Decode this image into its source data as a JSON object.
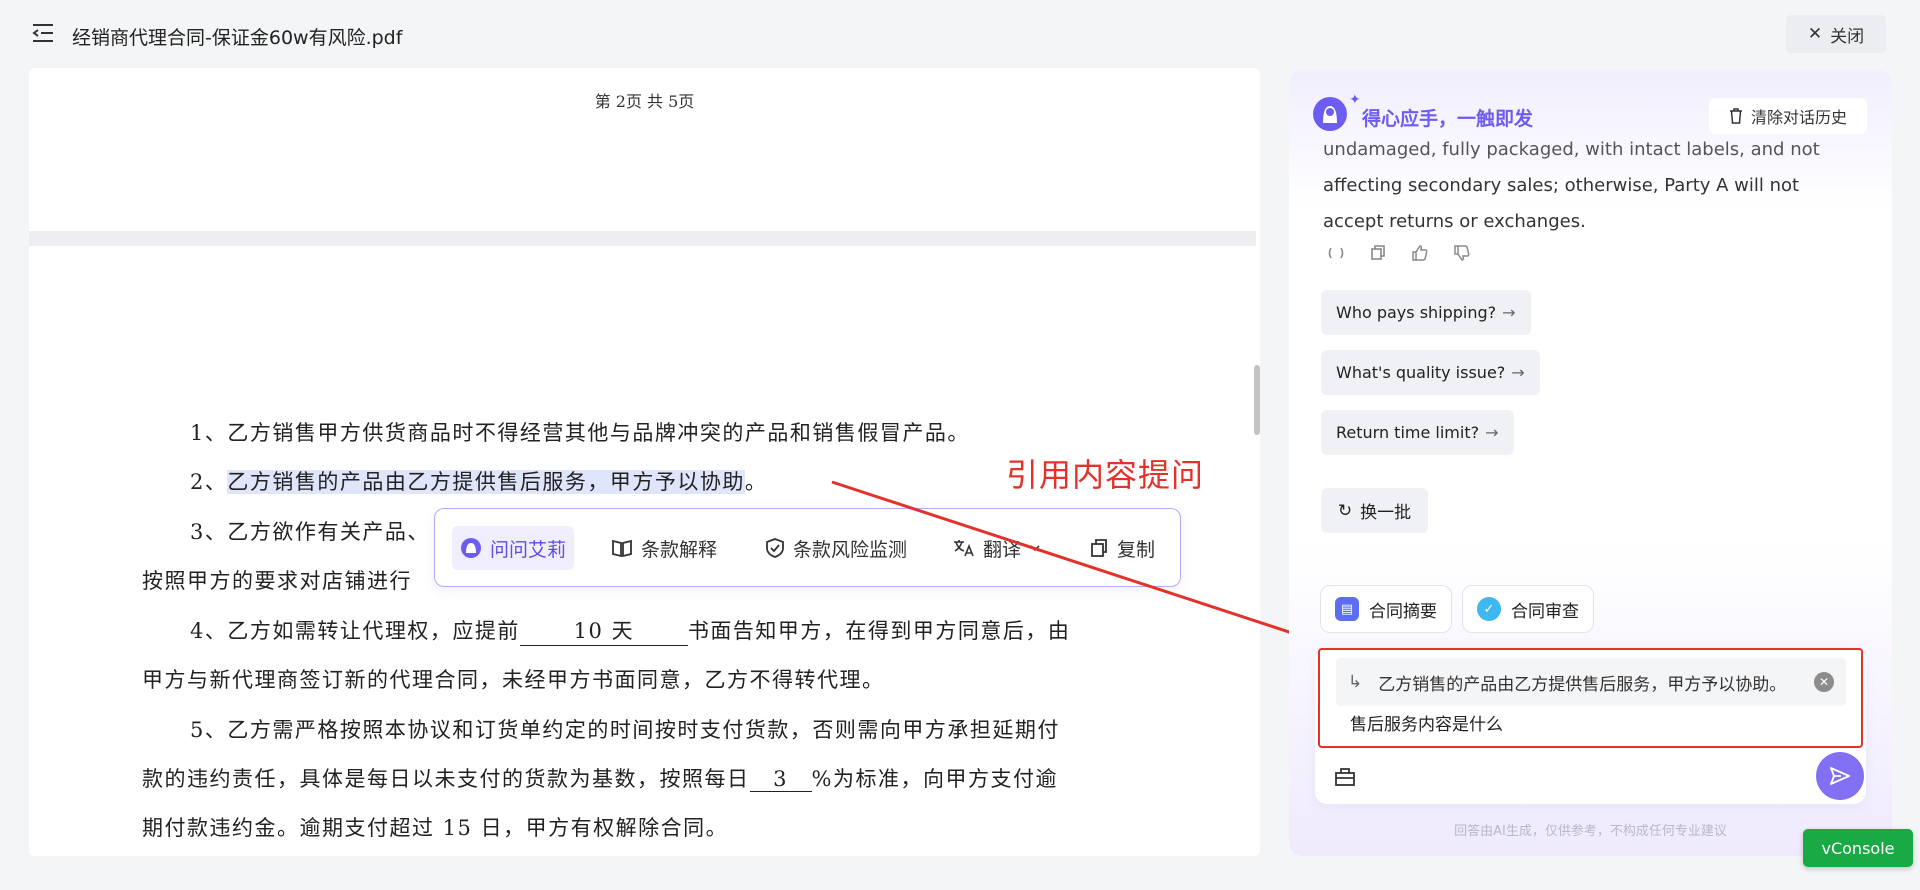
{
  "header": {
    "title": "经销商代理合同-保证金60w有风险.pdf",
    "close_label": "关闭"
  },
  "viewer": {
    "page_indicator": "第 2页  共 5页",
    "lines": {
      "l1": "1、乙方销售甲方供货商品时不得经营其他与品牌冲突的产品和销售假冒产品。",
      "l2_prefix": "2、",
      "l2_highlight": "乙方销售的产品由乙方提供售后服务，甲方予以协助",
      "l2_suffix": "。",
      "l3": "3、乙方欲作有关产品、",
      "l3b": "按照甲方的要求对店铺进行",
      "l4_a": "4、乙方如需转让代理权，应提前",
      "l4_ul": "10 天",
      "l4_b": "书面告知甲方，在得到甲方同意后，由",
      "l5": "甲方与新代理商签订新的代理合同，未经甲方书面同意，乙方不得转代理。",
      "l6": "5、乙方需严格按照本协议和订货单约定的时间按时支付货款，否则需向甲方承担延期付",
      "l7_a": "款的违约责任，具体是每日以未支付的货款为基数，按照每日",
      "l7_ul": "3",
      "l7_b": "%为标准，向甲方支付逾",
      "l8": "期付款违约金。逾期支付超过 15 日，甲方有权解除合同。"
    }
  },
  "selection_toolbar": {
    "ask": "问问艾莉",
    "explain": "条款解释",
    "risk": "条款风险监测",
    "translate": "翻译",
    "copy": "复制"
  },
  "annotation": {
    "label": "引用内容提问"
  },
  "assistant": {
    "brand": "得心应手，一触即发",
    "clear_history": "清除对话历史",
    "message_cut": "undamaged, fully packaged, with intact labels, and not",
    "message": "affecting secondary sales; otherwise, Party A will not accept returns or exchanges.",
    "suggestions": [
      "Who pays shipping?",
      "What's quality issue?",
      "Return time limit?"
    ],
    "refresh": "换一批",
    "chips": {
      "summary": "合同摘要",
      "review": "合同审查"
    },
    "quote": "乙方销售的产品由乙方提供售后服务，甲方予以协助。",
    "question": "售后服务内容是什么",
    "disclaimer": "回答由AI生成，仅供参考，不构成任何专业建议"
  },
  "vconsole": "vConsole",
  "colors": {
    "accent": "#6d5cf0",
    "annotation": "#e3322a",
    "vconsole": "#1aaa45"
  },
  "icons": [
    "menu-collapse-icon",
    "close-icon",
    "ask-ai-icon",
    "book-icon",
    "shield-check-icon",
    "translate-icon",
    "copy-icon",
    "trash-icon",
    "regenerate-icon",
    "thumb-up-icon",
    "thumb-down-icon",
    "refresh-icon",
    "toolbox-icon",
    "send-icon",
    "quote-arrow-icon"
  ]
}
